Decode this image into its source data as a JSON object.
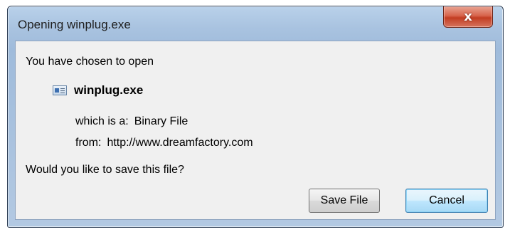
{
  "window": {
    "title": "Opening winplug.exe",
    "close_symbol": "x"
  },
  "dialog": {
    "intro": "You have chosen to open",
    "file": {
      "icon": "executable-file-icon",
      "name": "winplug.exe"
    },
    "type_label": "which is a:",
    "type_value": "Binary File",
    "from_label": "from:",
    "from_value": "http://www.dreamfactory.com",
    "question": "Would you like to save this file?"
  },
  "buttons": {
    "save_label": "Save File",
    "cancel_label": "Cancel"
  },
  "colors": {
    "frame": "#a9c3e0",
    "close_button": "#c23d22",
    "content_bg": "#f0f0f0",
    "focus_border": "#3c7fb1"
  }
}
